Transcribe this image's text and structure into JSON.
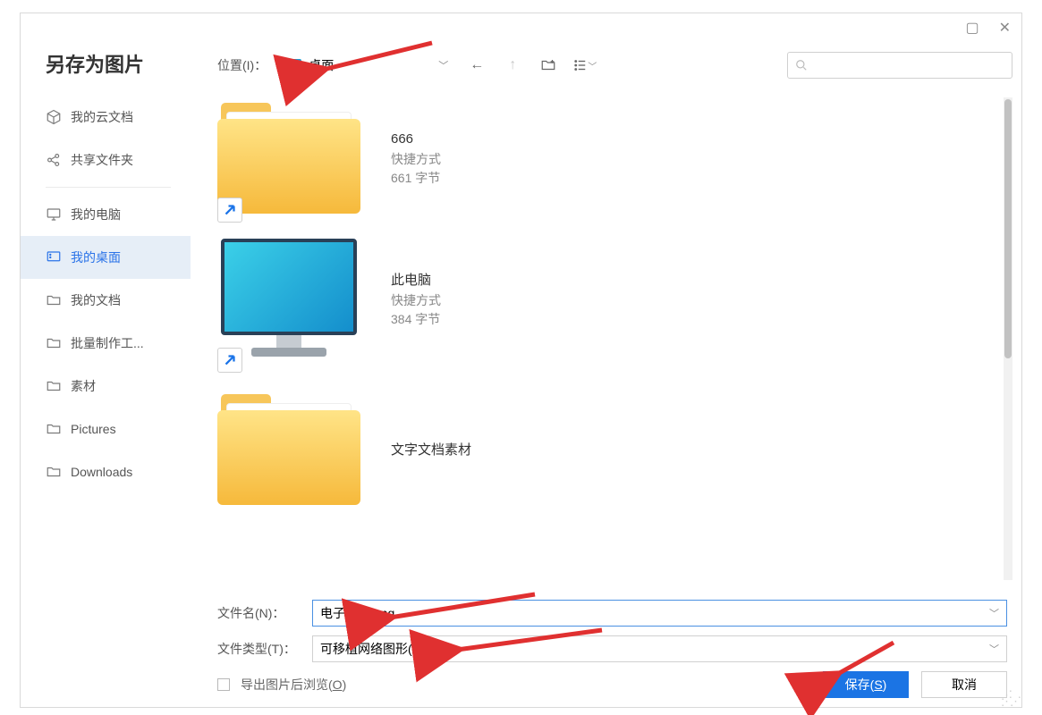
{
  "title": "另存为图片",
  "sidebar": {
    "items": [
      {
        "label": "我的云文档",
        "icon": "cube"
      },
      {
        "label": "共享文件夹",
        "icon": "share"
      },
      {
        "label": "我的电脑",
        "icon": "monitor"
      },
      {
        "label": "我的桌面",
        "icon": "desktop",
        "selected": true
      },
      {
        "label": "我的文档",
        "icon": "folder"
      },
      {
        "label": "批量制作工...",
        "icon": "folder"
      },
      {
        "label": "素材",
        "icon": "folder"
      },
      {
        "label": "Pictures",
        "icon": "folder"
      },
      {
        "label": "Downloads",
        "icon": "folder"
      }
    ]
  },
  "toolbar": {
    "location_label": "位置(I)：",
    "location_value": "桌面",
    "search_placeholder": ""
  },
  "files": [
    {
      "name": "666",
      "sub1": "快捷方式",
      "sub2": "661 字节",
      "kind": "folder",
      "shortcut": true
    },
    {
      "name": "此电脑",
      "sub1": "快捷方式",
      "sub2": "384 字节",
      "kind": "monitor",
      "shortcut": true
    },
    {
      "name": "文字文档素材",
      "sub1": "",
      "sub2": "",
      "kind": "folder",
      "shortcut": false
    }
  ],
  "form": {
    "filename_label": "文件名(N)：",
    "filename_value": "电子公章.png",
    "filetype_label": "文件类型(T)：",
    "filetype_value": "可移植网络图形(*.png)",
    "export_checkbox": "导出图片后浏览(",
    "export_checkbox_key": "O",
    "export_checkbox_end": ")",
    "save": "保存(",
    "save_key": "S",
    "save_end": ")",
    "cancel": "取消"
  }
}
